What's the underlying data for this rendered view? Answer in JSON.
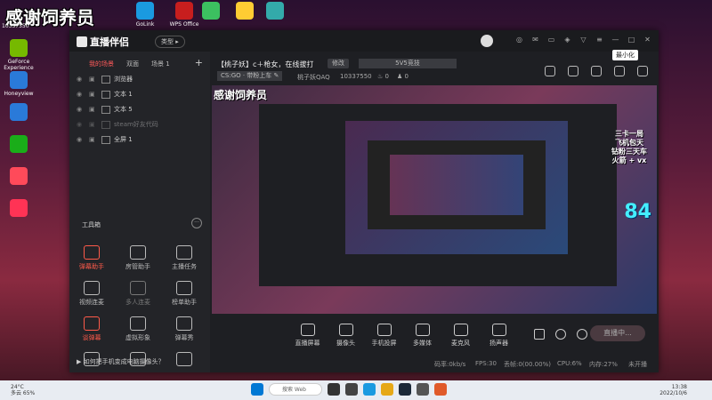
{
  "desktop": {
    "overlay_text": "感谢饲养员",
    "overlay_sub": "10337550",
    "left_icons": [
      {
        "label": "GeForce Experience",
        "color": "#76b900"
      },
      {
        "label": "Honeyview",
        "color": "#2a7ad9"
      },
      {
        "label": "",
        "color": "#2a7ad9"
      },
      {
        "label": "",
        "color": "#1aad19"
      },
      {
        "label": "",
        "color": "#ff4a5a"
      },
      {
        "label": "",
        "color": "#ff3355"
      }
    ],
    "top_icons": [
      {
        "label": "GoLink",
        "color": "#1a9ae0"
      },
      {
        "label": "WPS Office",
        "color": "#c81e1e"
      },
      {
        "label": "",
        "color": "#3cc060"
      },
      {
        "label": "",
        "color": "#ffcc33"
      },
      {
        "label": "",
        "color": "#3aa"
      }
    ]
  },
  "app": {
    "logo": "直播伴侣",
    "type_button": "类型",
    "tooltip": "最小化",
    "scene_tabs": [
      "我的场景",
      "双面",
      "场景 1"
    ],
    "sources": [
      "浏览器",
      "文本 1",
      "文本 5",
      "steam好友代码",
      "全屏 1"
    ],
    "tools_title": "工具箱",
    "tools": [
      {
        "label": "弹幕助手",
        "variant": "red"
      },
      {
        "label": "房管助手",
        "variant": ""
      },
      {
        "label": "主播任务",
        "variant": ""
      },
      {
        "label": "视频连麦",
        "variant": ""
      },
      {
        "label": "多人连麦",
        "variant": "dim"
      },
      {
        "label": "榜单助手",
        "variant": ""
      },
      {
        "label": "谈弹幕",
        "variant": "red"
      },
      {
        "label": "虚拟形象",
        "variant": ""
      },
      {
        "label": "弹幕秀",
        "variant": ""
      },
      {
        "label": "",
        "variant": ""
      },
      {
        "label": "",
        "variant": ""
      },
      {
        "label": "",
        "variant": ""
      }
    ],
    "tip": "如何把手机变成电脑摄像头？",
    "stream_title": "【桃子妖】c＋枪女，在线拔打",
    "edit_label": "修改",
    "game_tag": "5V5竞技",
    "category_tag": "CS:GO · 带粉上车",
    "room_name": "桃子妖QAQ",
    "room_id": "10337550",
    "hot_value": "0",
    "fans_value": "0",
    "preview": {
      "overlay": "感谢饲养员",
      "banner": "三卡一局\n飞机包天\n钻粉三天车\n火箭 + vx",
      "big_number": "84"
    },
    "bottom_tools": [
      "直播屏幕",
      "摄像头",
      "手机投屏",
      "多媒体",
      "麦克风",
      "扬声器"
    ],
    "live_button": "直播中...",
    "status": {
      "bitrate": "码率:0kb/s",
      "fps": "FPS:30",
      "dropped": "丢帧:0(00.00%)",
      "cpu": "CPU:6%",
      "memory": "内存:27%",
      "more": "未开播"
    }
  },
  "taskbar": {
    "weather": "24°C",
    "weather_sub": "多云 65%",
    "search": "搜索 Web",
    "time": "13:38",
    "date": "2022/10/6"
  }
}
